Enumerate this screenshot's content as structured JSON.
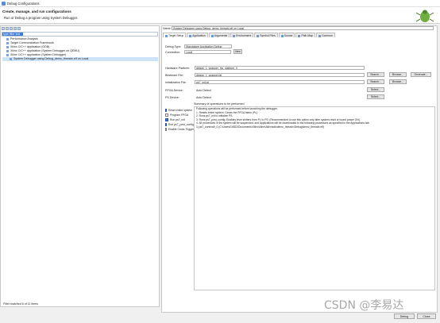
{
  "window": {
    "title": "Debug Configurations"
  },
  "header": {
    "title": "Create, manage, and run configurations",
    "subtitle": "Run or Debug a program using System Debugger."
  },
  "left": {
    "filter_placeholder": "type filter text",
    "tree": [
      {
        "label": "Performance Analysis",
        "level": 1,
        "selected": false
      },
      {
        "label": "Target Communication Framework",
        "level": 1,
        "selected": false
      },
      {
        "label": "Xilinx C/C++ application (GDB)",
        "level": 1,
        "selected": false
      },
      {
        "label": "Xilinx C/C++ application (System Debugger on QEMU)",
        "level": 1,
        "selected": false
      },
      {
        "label": "Xilinx C/C++ application (System Debugger)",
        "level": 1,
        "selected": false
      },
      {
        "label": "System Debugger using Debug_demo_threadx.elf on Local",
        "level": 2,
        "selected": true
      }
    ],
    "status": "Filter matched 6 of 11 items"
  },
  "config": {
    "name_label": "Name:",
    "name_value": "System Debugger using Debug_demo_threadx.elf on Local",
    "tabs": [
      "Target Setup",
      "Application",
      "Arguments",
      "Environment",
      "Symbol Files",
      "Source",
      "Path Map",
      "Common"
    ],
    "debug_type_label": "Debug Type:",
    "debug_type_value": "Standalone Application Debug",
    "connection_label": "Connection:",
    "connection_value": "Local",
    "new_label": "New",
    "hw_platform_label": "Hardware Platform:",
    "hw_platform_value": "design_1_wrapper_hw_platform_0",
    "bitstream_label": "Bitstream File:",
    "bitstream_value": "design_1_wrapper.bit",
    "init_label": "Initialization File:",
    "init_value": "ps7_init.tcl",
    "fpga_label": "FPGA Device:",
    "fpga_value": "Auto Detect",
    "ps_label": "PS Device:",
    "ps_value": "Auto Detect",
    "search_label": "Search...",
    "browse_label": "Browse...",
    "generate_label": "Generate...",
    "select_label": "Select..."
  },
  "options": [
    {
      "label": "Reset entire system",
      "checked": true
    },
    {
      "label": "Program FPGA",
      "checked": false
    },
    {
      "label": "Run ps7_init",
      "checked": true
    },
    {
      "label": "Run ps7_post_config",
      "checked": true
    },
    {
      "label": "Enable Cross-Triggering",
      "checked": false
    }
  ],
  "summary": {
    "title": "Summary of operations to be performed",
    "lines": [
      "Following operations will be performed before launching the debugger.",
      "1. Resets entire system. Clears the FPGA fabric (PL).",
      "2. Runs ps7_init to initialize PS.",
      "3. Runs ps7_post_config. Enables level shifters from PL to PS. (Recommended to use this option only after system reset or board power ON).",
      "4. All processors in the system will be suspended, and Applications will be downloaded to the following processors as specified in the Applications tab.",
      "    1) ps7_cortexa9_0 (C:\\Users\\15522\\Documents\\Xilinx\\Alinx\\Alinx\\sdk\\demo_threadx\\Debug\\demo_threadx.elf)"
    ]
  },
  "footer": {
    "debug_label": "Debug",
    "close_label": "Close"
  },
  "watermark": "CSDN @李易达"
}
